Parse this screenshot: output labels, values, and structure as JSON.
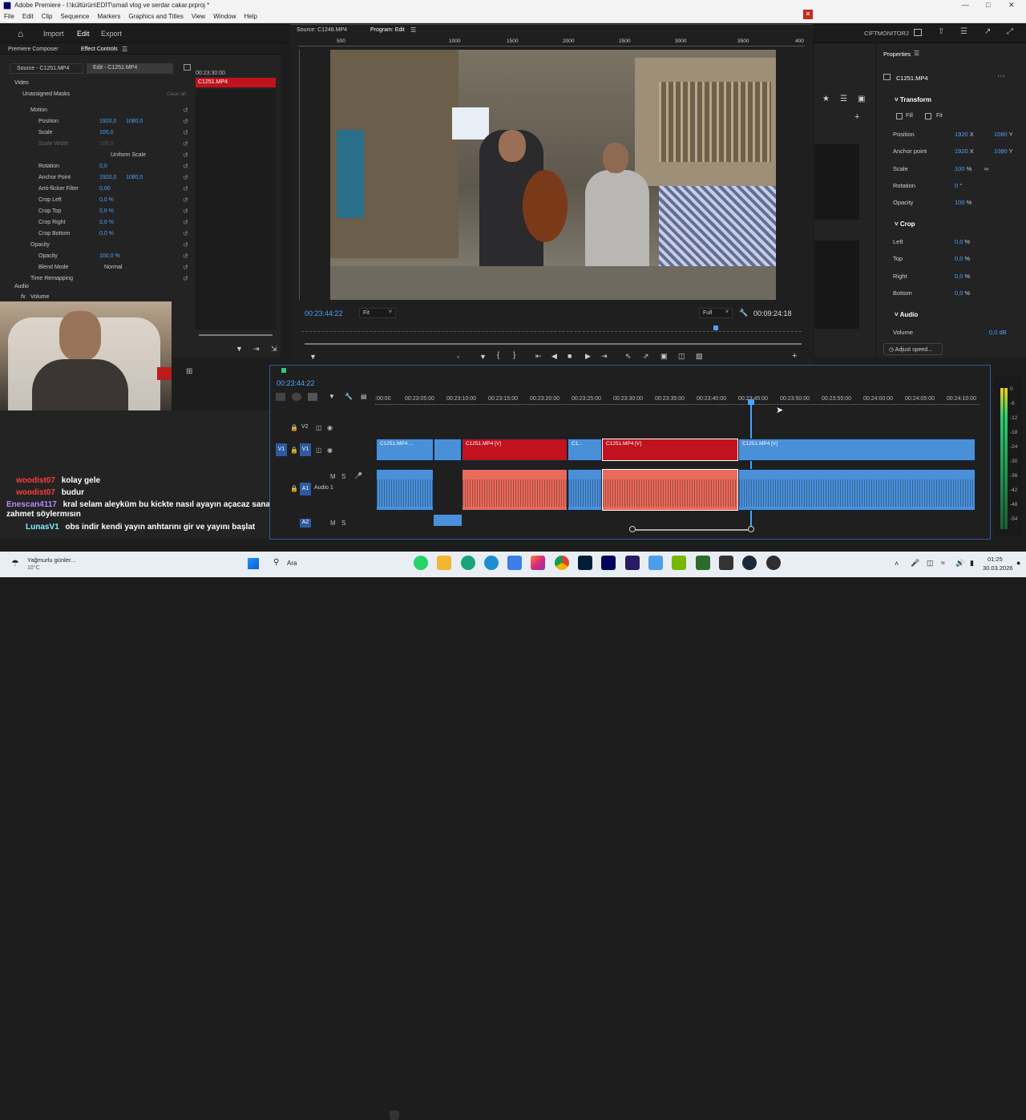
{
  "window": {
    "title": "Adobe Premiere - I:\\kültürün\\EDİT\\smail vlog ve serdar cakar.prproj *"
  },
  "menu": [
    "File",
    "Edit",
    "Clip",
    "Sequence",
    "Markers",
    "Graphics and Titles",
    "View",
    "Window",
    "Help"
  ],
  "header": {
    "tabs": [
      "Import",
      "Edit",
      "Export"
    ],
    "active_tab": "Edit",
    "workspace_name": "CIFTMONITOR2"
  },
  "left_tabs": {
    "premiere_composer": "Premiere Composer",
    "effect_controls": "Effect Controls",
    "source_tab": "Source - C1251.MP4",
    "edit_tab": "Edit - C1251.MP4"
  },
  "effect_controls": {
    "timecode": "00:23:30:00",
    "clip_label": "C1251.MP4",
    "video_label": "Video",
    "masks": "Unassigned Masks",
    "clear_all": "Clear all",
    "rows": [
      {
        "label": "Motion",
        "v1": "",
        "v2": ""
      },
      {
        "label": "Position",
        "v1": "1920,0",
        "v2": "1080,0"
      },
      {
        "label": "Scale",
        "v1": "100,0",
        "v2": ""
      },
      {
        "label": "Scale Width",
        "v1": "100,0",
        "v2": ""
      },
      {
        "label": "Uniform Scale",
        "v1": "",
        "v2": ""
      },
      {
        "label": "Rotation",
        "v1": "0,0",
        "v2": ""
      },
      {
        "label": "Anchor Point",
        "v1": "1920,0",
        "v2": "1080,0"
      },
      {
        "label": "Anti-flicker Filter",
        "v1": "0,00",
        "v2": ""
      },
      {
        "label": "Crop Left",
        "v1": "0,0 %",
        "v2": ""
      },
      {
        "label": "Crop Top",
        "v1": "0,0 %",
        "v2": ""
      },
      {
        "label": "Crop Right",
        "v1": "0,0 %",
        "v2": ""
      },
      {
        "label": "Crop Bottom",
        "v1": "0,0 %",
        "v2": ""
      },
      {
        "label": "Opacity",
        "v1": "",
        "v2": ""
      },
      {
        "label": "Opacity",
        "v1": "100,0 %",
        "v2": ""
      },
      {
        "label": "Blend Mode",
        "v1": "Normal",
        "v2": ""
      },
      {
        "label": "Time Remapping",
        "v1": "",
        "v2": ""
      }
    ],
    "audio_label": "Audio",
    "volume_label": "Volume"
  },
  "chat": [
    {
      "user": "woodist07",
      "msg": "kolay gele",
      "color": "#ff3b3b"
    },
    {
      "user": "woodist07",
      "msg": "budur",
      "color": "#ff3b3b"
    },
    {
      "user": "Enescan4117",
      "msg": "kral selam aleyküm bu kickte nasıl ayayın açacaz sana zahmet söylermısın",
      "color": "#b88bff"
    },
    {
      "user": "LunasV1",
      "msg": "obs indir kendi yayın anhtarını gir ve yayını başlat",
      "color": "#7ff0ff"
    }
  ],
  "monitor": {
    "source_tab": "Source: C1248.MP4",
    "program_tab": "Program: Edit",
    "ruler": [
      "500",
      "1000",
      "1500",
      "2000",
      "2500",
      "3000",
      "3500",
      "400"
    ],
    "timecode_left": "00:23:44:22",
    "fit": "Fit",
    "quality": "Full",
    "timecode_right": "00:09:24:18"
  },
  "properties": {
    "title": "Properties",
    "clip": "C1251.MP4",
    "transform": "Transform",
    "fill": "Fill",
    "fit": "Fit",
    "position": {
      "label": "Position",
      "x": "1920",
      "y": "1080",
      "xu": "X",
      "yu": "Y"
    },
    "anchor": {
      "label": "Anchor point",
      "x": "1920",
      "y": "1080",
      "xu": "X",
      "yu": "Y"
    },
    "scale": {
      "label": "Scale",
      "v": "100",
      "u": "%"
    },
    "rotation": {
      "label": "Rotation",
      "v": "0",
      "u": "°"
    },
    "opacity": {
      "label": "Opacity",
      "v": "100",
      "u": "%"
    },
    "crop": "Crop",
    "crop_left": {
      "label": "Left",
      "v": "0,0",
      "u": "%"
    },
    "crop_top": {
      "label": "Top",
      "v": "0,0",
      "u": "%"
    },
    "crop_right": {
      "label": "Right",
      "v": "0,0",
      "u": "%"
    },
    "crop_bottom": {
      "label": "Bottom",
      "v": "0,0",
      "u": "%"
    },
    "audio": "Audio",
    "volume": {
      "label": "Volume",
      "v": "0,0 dB"
    },
    "adjust_speed": "Adjust speed..."
  },
  "timeline": {
    "timecode": "00:23:44:22",
    "ruler": [
      ":00:00",
      "00:23:05:00",
      "00:23:10:00",
      "00:23:15:00",
      "00:23:20:00",
      "00:23:25:00",
      "00:23:30:00",
      "00:23:35:00",
      "00:23:40:00",
      "00:23:45:00",
      "00:23:50:00",
      "00:23:55:00",
      "00:24:00:00",
      "00:24:05:00",
      "00:24:10:00"
    ],
    "tracks": {
      "v2": "V2",
      "v1": "V1",
      "a1": "A1",
      "a1_name": "Audio 1",
      "a2": "A2"
    },
    "clips": {
      "c1": "C1251.MP4 ...",
      "c2": "C1251.MP4 [V]",
      "c3": "C1...",
      "c4": "C1251.MP4 [V]",
      "c5": "C1251.MP4 [V]"
    },
    "meter": [
      "0",
      "-6",
      "-12",
      "-18",
      "-24",
      "-30",
      "-36",
      "-42",
      "-48",
      "-54"
    ]
  },
  "taskbar": {
    "weather": "Yağmurlu günler...",
    "temp": "10°C",
    "search": "Ara",
    "time": "01:25",
    "date": "30.03.2026"
  }
}
